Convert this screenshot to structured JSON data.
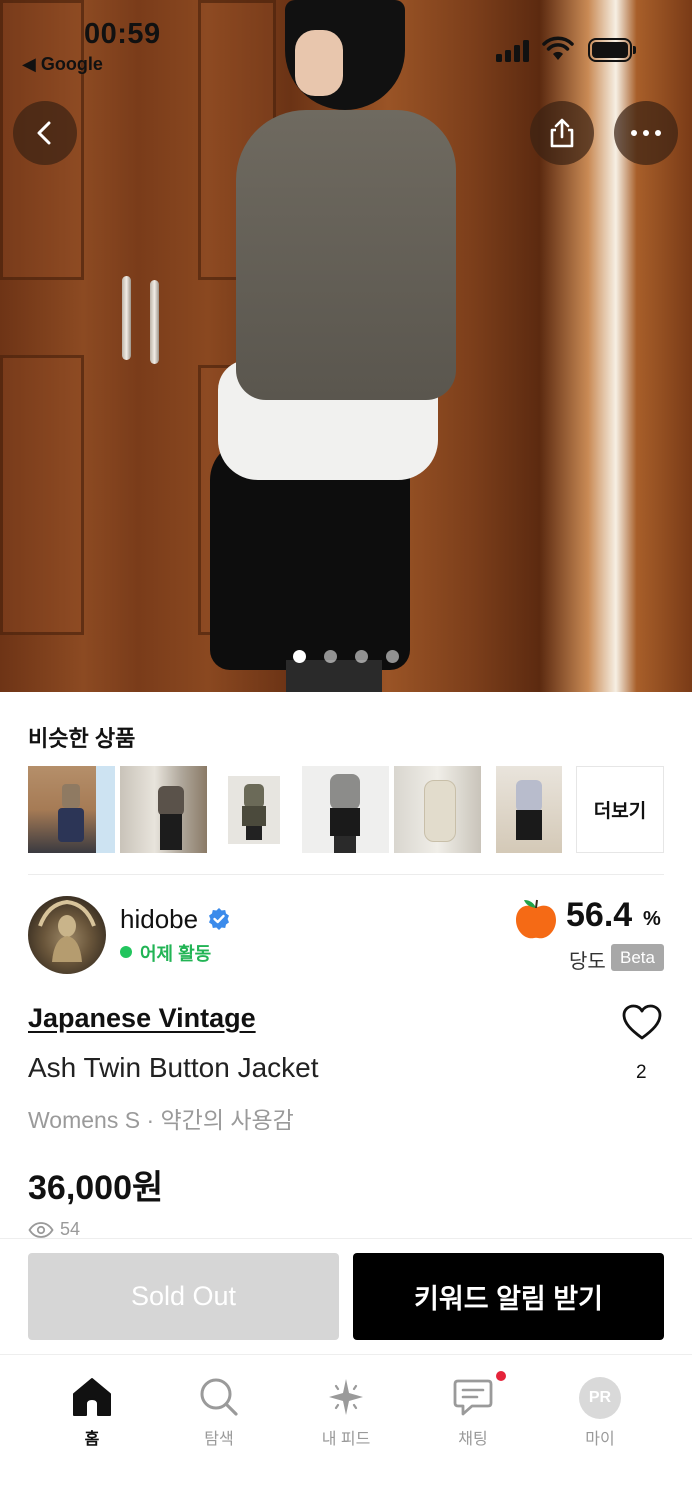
{
  "status_bar": {
    "time": "00:59",
    "back_app": "◀ Google"
  },
  "similar": {
    "title": "비슷한 상품",
    "more_label": "더보기",
    "thumbnails": [
      "similar-product-1",
      "similar-product-2",
      "similar-product-3",
      "similar-product-4",
      "similar-product-5",
      "similar-product-6"
    ]
  },
  "seller": {
    "name": "hidobe",
    "activity": "어제 활동",
    "sweetness_value": "56.4",
    "sweetness_unit": "%",
    "sweetness_label": "당도",
    "beta_label": "Beta"
  },
  "product": {
    "brand": "Japanese Vintage",
    "name": "Ash Twin Button Jacket",
    "meta": "Womens S · 약간의 사용감",
    "price": "36,000원",
    "views": "54",
    "likes": "2"
  },
  "actions": {
    "sold_out_label": "Sold Out",
    "keyword_alert_label": "키워드 알림 받기"
  },
  "tabbar": {
    "items": [
      {
        "label": "홈",
        "icon": "home-icon"
      },
      {
        "label": "탐색",
        "icon": "search-icon"
      },
      {
        "label": "내 피드",
        "icon": "sparkle-icon"
      },
      {
        "label": "채팅",
        "icon": "chat-icon"
      },
      {
        "label": "마이",
        "icon": "profile-avatar"
      }
    ],
    "avatar_initials": "PR"
  },
  "colors": {
    "active_green": "#22b455",
    "brand_black": "#000000",
    "disabled_gray": "#d6d6d6",
    "notify_red": "#e5233a"
  }
}
